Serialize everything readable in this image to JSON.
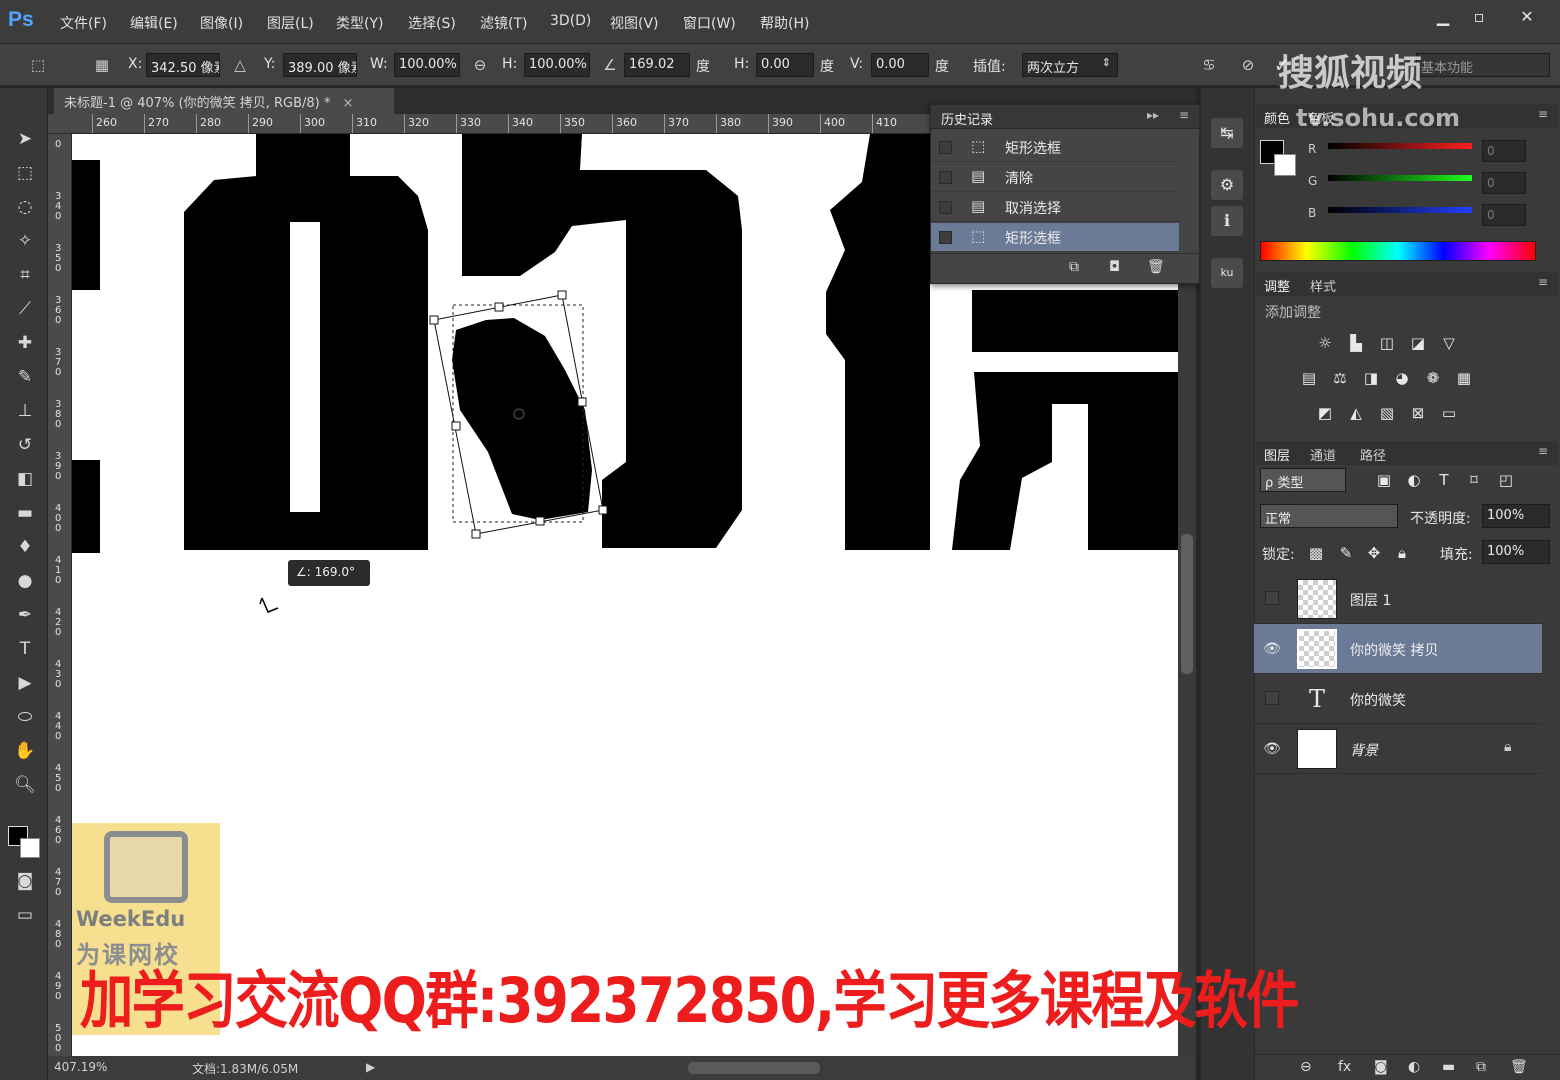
{
  "app": {
    "logo": "Ps"
  },
  "menu": [
    "文件(F)",
    "编辑(E)",
    "图像(I)",
    "图层(L)",
    "类型(Y)",
    "选择(S)",
    "滤镜(T)",
    "3D(D)",
    "视图(V)",
    "窗口(W)",
    "帮助(H)"
  ],
  "options": {
    "x_label": "X:",
    "x_value": "342.50 像素",
    "y_label": "Y:",
    "y_value": "389.00 像素",
    "w_label": "W:",
    "w_value": "100.00%",
    "h_label": "H:",
    "h_value": "100.00%",
    "angle_value": "169.02",
    "angle_unit": "度",
    "hskew_label": "H:",
    "hskew_value": "0.00",
    "hskew_unit": "度",
    "vskew_label": "V:",
    "vskew_value": "0.00",
    "vskew_unit": "度",
    "interp_label": "插值:",
    "interp_value": "两次立方",
    "workspace_value": "基本功能"
  },
  "document": {
    "tab_title": "未标题-1 @ 407% (你的微笑 拷贝, RGB/8) *",
    "angle_tooltip": "∠: 169.0°",
    "zoom": "407.19%",
    "doc_info": "文档:1.83M/6.05M"
  },
  "ruler_h": [
    "260",
    "270",
    "280",
    "290",
    "300",
    "310",
    "320",
    "330",
    "340",
    "350",
    "360",
    "370",
    "380",
    "390",
    "400",
    "410"
  ],
  "ruler_v": [
    "0",
    "3 4 0",
    "3 5 0",
    "3 6 0",
    "3 7 0",
    "3 8 0",
    "3 9 0",
    "4 0 0",
    "4 1 0",
    "4 2 0",
    "4 3 0",
    "4 4 0",
    "4 5 0",
    "4 6 0",
    "4 7 0",
    "4 8 0",
    "4 9 0",
    "5 0 0"
  ],
  "history": {
    "title": "历史记录",
    "items": [
      {
        "label": "矩形选框",
        "icon": "marquee-icon",
        "selected": false
      },
      {
        "label": "清除",
        "icon": "document-icon",
        "selected": false
      },
      {
        "label": "取消选择",
        "icon": "document-icon",
        "selected": false
      },
      {
        "label": "矩形选框",
        "icon": "marquee-icon",
        "selected": true
      }
    ]
  },
  "color_panel": {
    "tabs": [
      "颜色",
      "色板"
    ],
    "r_label": "R",
    "g_label": "G",
    "b_label": "B",
    "r_value": "0",
    "g_value": "0",
    "b_value": "0"
  },
  "adjust_panel": {
    "tabs": [
      "调整",
      "样式"
    ],
    "hint": "添加调整"
  },
  "layers_panel": {
    "tabs": [
      "图层",
      "通道",
      "路径"
    ],
    "filter_label": "ρ 类型",
    "blend_mode": "正常",
    "opacity_label": "不透明度:",
    "opacity_value": "100%",
    "lock_label": "锁定:",
    "fill_label": "填充:",
    "fill_value": "100%",
    "layers": [
      {
        "name": "图层 1",
        "visible": false,
        "selected": false,
        "kind": "pixel"
      },
      {
        "name": "你的微笑 拷贝",
        "visible": true,
        "selected": true,
        "kind": "pixel"
      },
      {
        "name": "你的微笑",
        "visible": false,
        "selected": false,
        "kind": "text"
      },
      {
        "name": "背景",
        "visible": true,
        "selected": false,
        "kind": "background"
      }
    ]
  },
  "watermarks": {
    "banner": "加学习交流QQ群:392372850,学习更多课程及软件",
    "sohu": "搜狐视频",
    "sohu_url": "tv.sohu.com",
    "weekedu": "WeekEdu",
    "weekedu_cn": "为课网校"
  },
  "colors": {
    "accent_selection": "#6b7a96",
    "banner_red": "#ee1d1d",
    "ps_blue": "#4fa6ff"
  }
}
